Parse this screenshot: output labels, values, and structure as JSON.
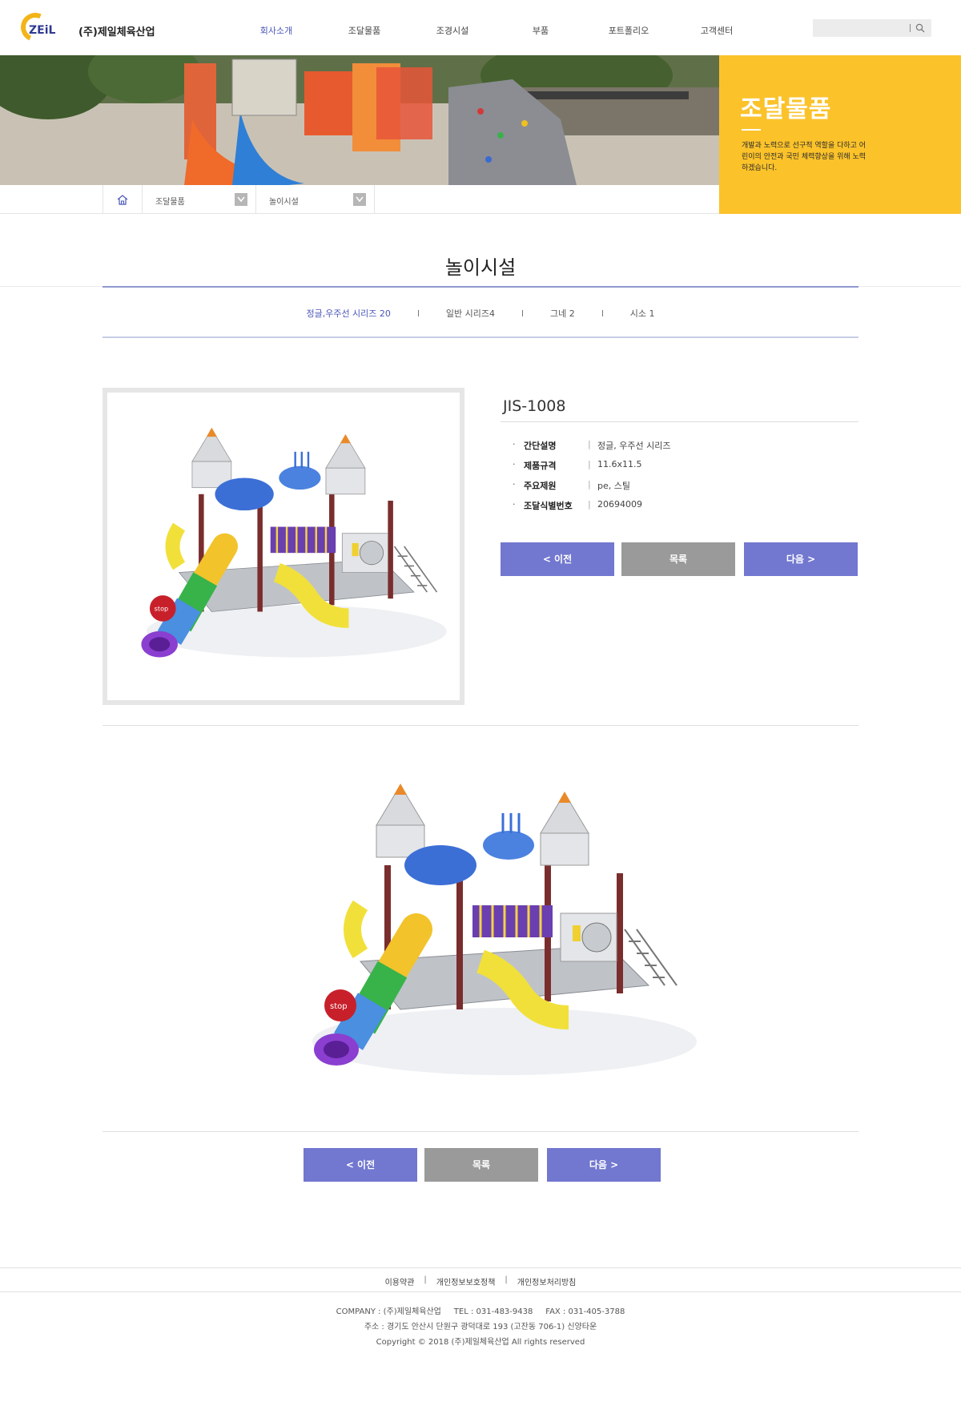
{
  "header": {
    "logo_mark": "ZEiL",
    "company": "(주)제일체육산업",
    "nav": [
      "회사소개",
      "조달물품",
      "조경시설",
      "부품",
      "포트폴리오",
      "고객센터"
    ],
    "search_placeholder": ""
  },
  "banner": {
    "title": "조달물품",
    "description": "개발과 노력으로 선구적 역할을 다하고 어린이의 안전과 국민 체력향상을 위해 노력하겠습니다."
  },
  "breadcrumb": {
    "level1": "조달물품",
    "level2": "놀이시설"
  },
  "page": {
    "title": "놀이시설",
    "tabs": [
      "정글,우주선 시리즈 20",
      "일반 시리즈4",
      "그네 2",
      "시소 1"
    ]
  },
  "product": {
    "name": "JIS-1008",
    "specs": [
      {
        "key": "간단설명",
        "value": "정글, 우주선 시리즈"
      },
      {
        "key": "제품규격",
        "value": "11.6x11.5"
      },
      {
        "key": "주요제원",
        "value": "pe, 스틸"
      },
      {
        "key": "조달식별번호",
        "value": "20694009"
      }
    ],
    "image_stop_text": "stop"
  },
  "buttons": {
    "prev": "< 이전",
    "list": "목록",
    "next": "다음 >"
  },
  "footer": {
    "links": [
      "이용약관",
      "개인정보보호정책",
      "개인정보처리방침"
    ],
    "company_line": "COMPANY : (주)제일체육산업     TEL : 031-483-9438     FAX : 031-405-3788",
    "address_line": "주소 : 경기도 안산시 단원구 광덕대로 193 (고잔동 706-1) 신양타운",
    "copyright": "Copyright © 2018 (주)제일체육산업 All rights reserved"
  },
  "colors": {
    "accent_yellow": "#fbc22a",
    "nav_active": "#4a56b8",
    "button_blue": "#7277cf",
    "button_gray": "#9a9a9a"
  }
}
